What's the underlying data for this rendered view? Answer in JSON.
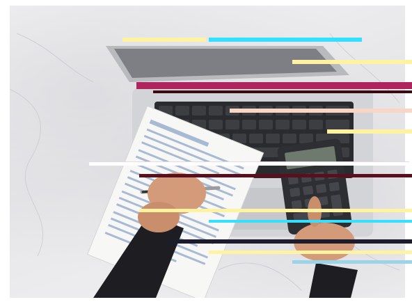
{
  "image": {
    "palette": {
      "marble": "#ececee",
      "laptop_silver": "#c9cacd",
      "keyboard_dark": "#2a2b2e",
      "paper": "#f7f7f5",
      "form_blue": "#8ea6c8",
      "skin": "#d39b7a",
      "sleeve": "#1e1e22",
      "calculator": "#2e2f33",
      "glitch_cyan": "#33e0ff",
      "glitch_yellow": "#fff2a0",
      "glitch_magenta": "#b0245e"
    },
    "objects": [
      "marble-surface",
      "laptop",
      "tax-form",
      "pen",
      "calculator",
      "left-hand",
      "right-hand"
    ]
  }
}
